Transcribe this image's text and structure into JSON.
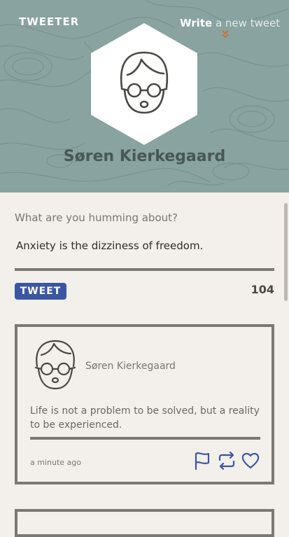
{
  "header": {
    "logo": "TWEETER",
    "write_bold": "Write",
    "write_light": "a new tweet",
    "user_name": "Søren Kierkegaard"
  },
  "composer": {
    "prompt": "What are you humming about?",
    "text": "Anxiety is the dizziness of freedom.",
    "tweet_button": "TWEET",
    "char_count": "104"
  },
  "tweets": [
    {
      "author": "Søren Kierkegaard",
      "text": "Life is not a problem to be solved, but a reality to be experienced.",
      "time": "a minute ago",
      "actions": [
        "flag-icon",
        "retweet-icon",
        "heart-icon"
      ]
    }
  ],
  "colors": {
    "header_bg": "#88a3a0",
    "page_bg": "#f3f0eb",
    "accent_blue": "#3a56a3",
    "chevron": "#c8723a",
    "border": "#7b7973"
  }
}
